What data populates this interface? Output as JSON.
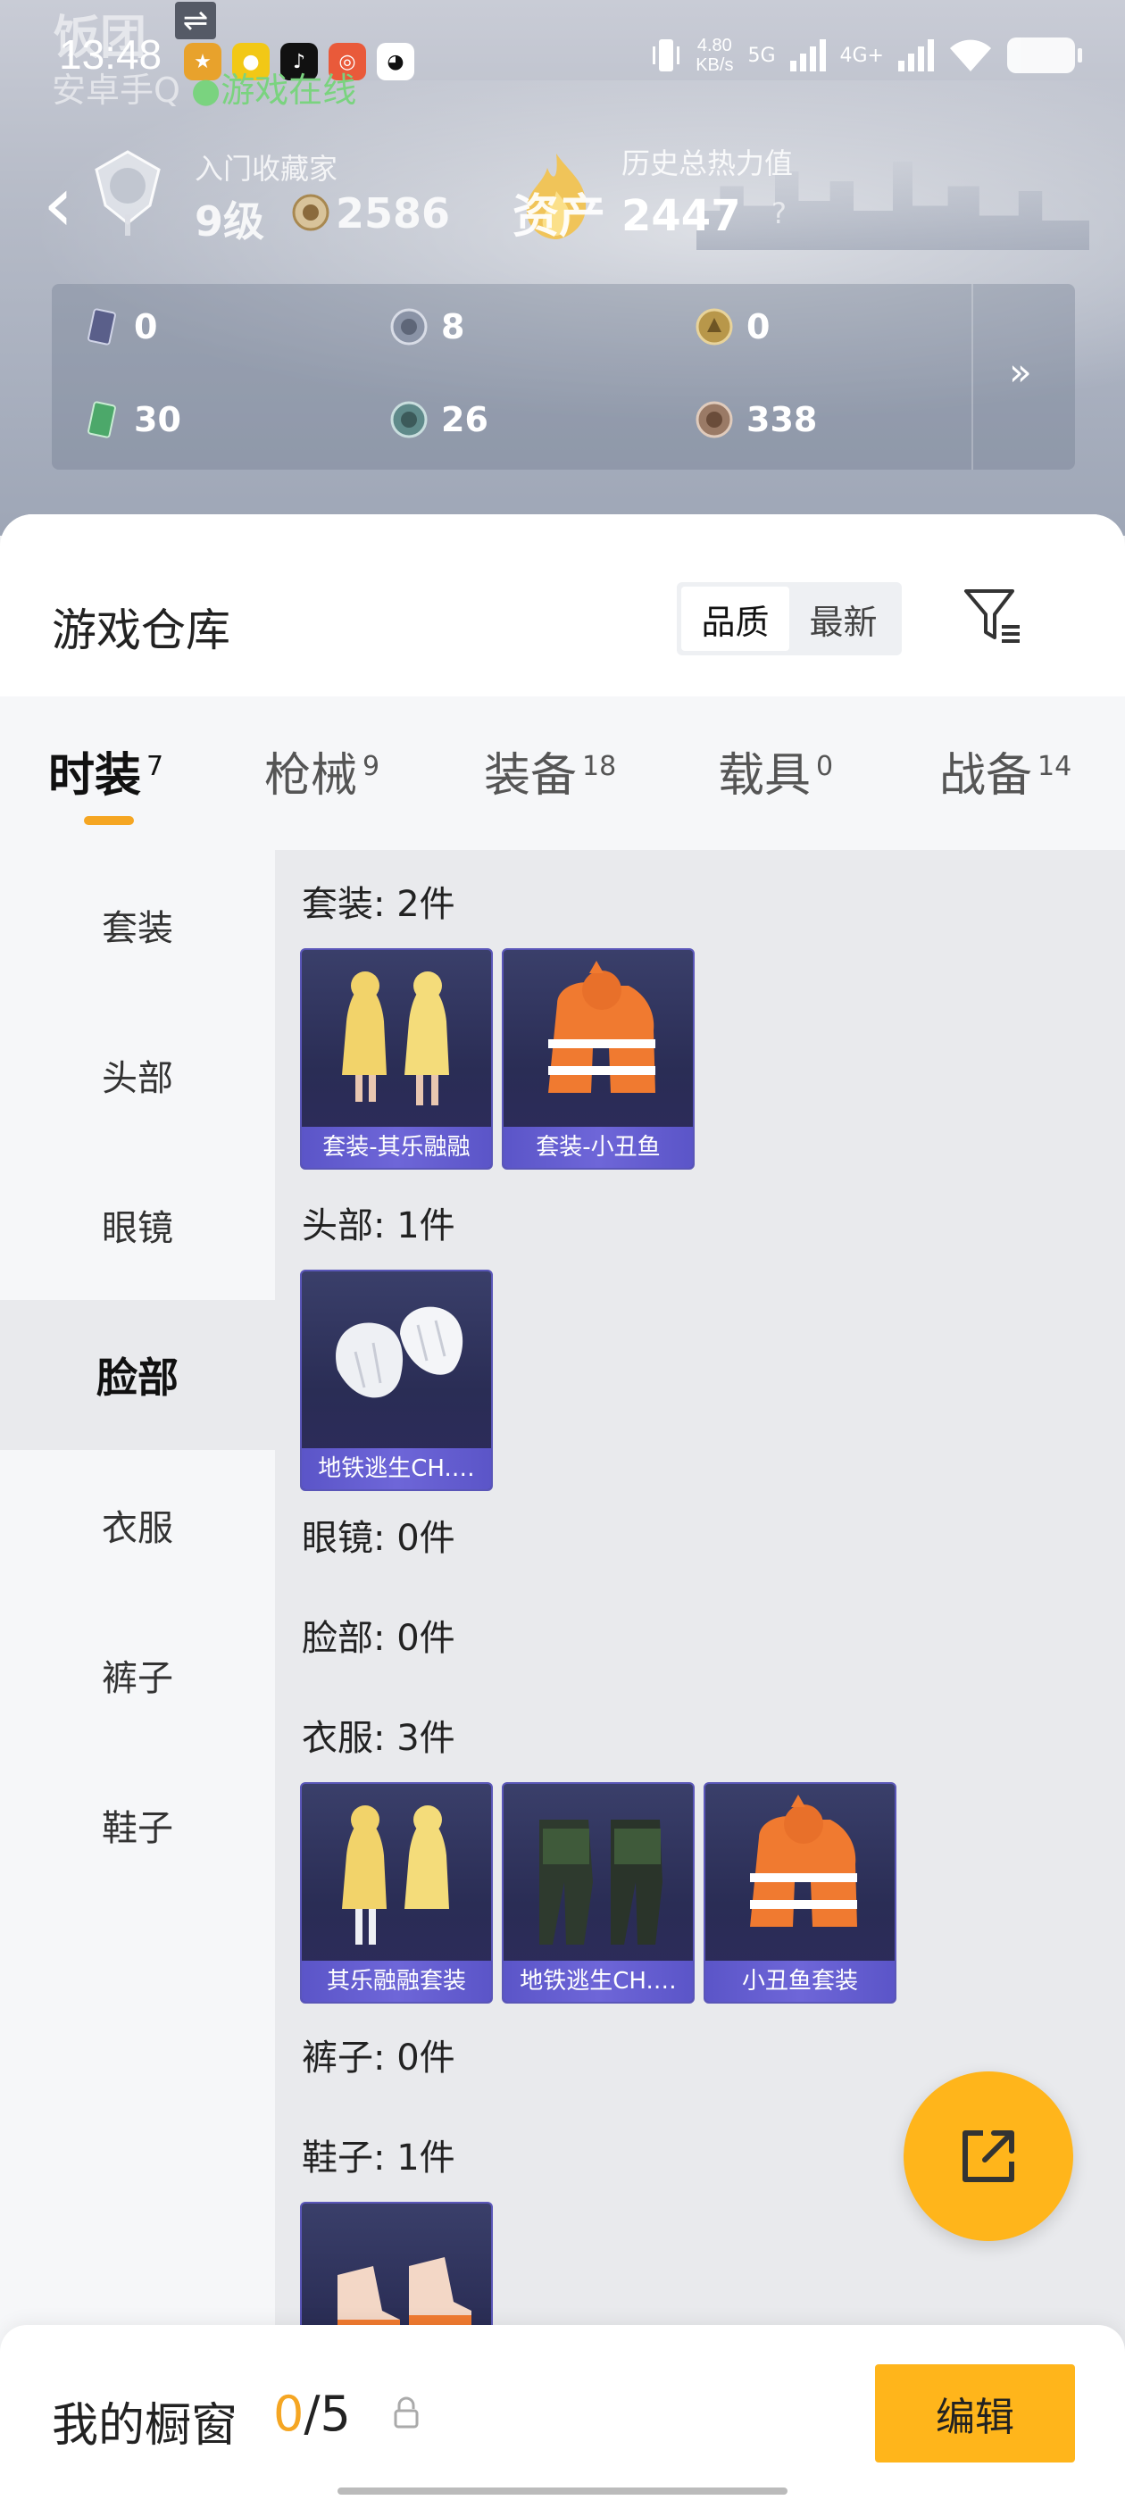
{
  "status_bar": {
    "ghost_text": "饭团",
    "time": "13:48",
    "swap_glyph": "⇌",
    "sub_text": "安卓手Q",
    "online_text": "游戏在线",
    "net_speed": "4.80",
    "net_unit": "KB/s",
    "sig_5g": "5G",
    "sig_4g": "4G+"
  },
  "profile": {
    "collector_title": "入门收藏家",
    "level": "9级",
    "coins": "2586",
    "asset_label": "资产",
    "heat_title": "历史总热力值",
    "heat_value": "2447",
    "help": "?"
  },
  "stats": [
    {
      "icon": "card-icon",
      "value": "0",
      "color": "#6a6f9a"
    },
    {
      "icon": "silver-medal-icon",
      "value": "8",
      "color": "#8a93a6"
    },
    {
      "icon": "gold-medal-icon",
      "value": "0",
      "color": "#b8974a"
    },
    {
      "icon": "green-card-icon",
      "value": "30",
      "color": "#4ca86a"
    },
    {
      "icon": "teal-coin-icon",
      "value": "26",
      "color": "#5f8a8a"
    },
    {
      "icon": "bronze-coin-icon",
      "value": "338",
      "color": "#9a7a66"
    }
  ],
  "warehouse": {
    "title": "游戏仓库",
    "sort_options": [
      "品质",
      "最新"
    ],
    "sort_active": "品质"
  },
  "tabs": [
    {
      "label": "时装",
      "count": "7"
    },
    {
      "label": "枪械",
      "count": "9"
    },
    {
      "label": "装备",
      "count": "18"
    },
    {
      "label": "载具",
      "count": "0"
    },
    {
      "label": "战备",
      "count": "14"
    }
  ],
  "side_nav": [
    "套装",
    "头部",
    "眼镜",
    "脸部",
    "衣服",
    "裤子",
    "鞋子"
  ],
  "sections": {
    "suit": {
      "title": "套装: 2件",
      "items": [
        "套装-其乐融融",
        "套装-小丑鱼"
      ]
    },
    "head": {
      "title": "头部: 1件",
      "items": [
        "地铁逃生CH.…"
      ]
    },
    "glasses": {
      "title": "眼镜: 0件"
    },
    "face": {
      "title": "脸部: 0件"
    },
    "clothes": {
      "title": "衣服: 3件",
      "items": [
        "其乐融融套装",
        "地铁逃生CH.…",
        "小丑鱼套装"
      ]
    },
    "pants": {
      "title": "裤子: 0件"
    },
    "shoes": {
      "title": "鞋子: 1件"
    }
  },
  "bottom_bar": {
    "showcase_label": "我的橱窗",
    "showcase_current": "0",
    "showcase_total": "/5",
    "edit_label": "编辑"
  },
  "colors": {
    "accent": "#ffb51b",
    "tab_underline": "#f5a623",
    "card_label": "#5b55c8"
  }
}
